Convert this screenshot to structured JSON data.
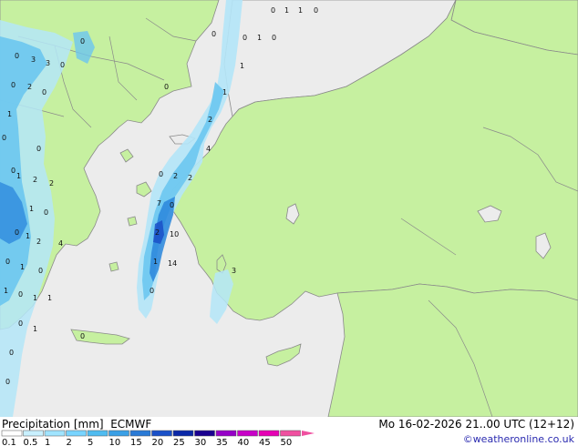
{
  "legend": {
    "title": "Precipitation [mm]",
    "model": "ECMWF",
    "datetime": "Mo 16-02-2026 21..00 UTC (12+12)",
    "credit": "©weatheronline.co.uk",
    "scale_labels": [
      "0.1",
      "0.5",
      "1",
      "2",
      "5",
      "10",
      "15",
      "20",
      "25",
      "30",
      "35",
      "40",
      "45",
      "50"
    ],
    "scale_colors": [
      "#ffffff",
      "#c8f0ff",
      "#a0e4ff",
      "#78d4ff",
      "#50bcf0",
      "#3aa0e6",
      "#2a7ad6",
      "#1a50c8",
      "#0a28a8",
      "#1a0090",
      "#9600c8",
      "#c800c8",
      "#e600b4",
      "#f050a0"
    ]
  },
  "colors": {
    "sea": "#ececec",
    "land": "#c6f0a0",
    "border": "#8a8a8a",
    "precip_light": "#b4e6f8",
    "precip_mid": "#6cc6f0",
    "precip_heavy": "#2a86dc",
    "precip_core": "#1a50c8"
  },
  "map_labels": [
    {
      "text": "0"
    },
    {
      "text": "1"
    },
    {
      "text": "1"
    },
    {
      "text": "0"
    },
    {
      "text": "0"
    },
    {
      "text": "1"
    },
    {
      "text": "0"
    },
    {
      "text": "0"
    },
    {
      "text": "3"
    },
    {
      "text": "3"
    },
    {
      "text": "0"
    },
    {
      "text": "0"
    },
    {
      "text": "2"
    },
    {
      "text": "0"
    },
    {
      "text": "0"
    },
    {
      "text": "0"
    },
    {
      "text": "1"
    },
    {
      "text": "0"
    },
    {
      "text": "1"
    },
    {
      "text": "2"
    },
    {
      "text": "2"
    },
    {
      "text": "0"
    },
    {
      "text": "1"
    },
    {
      "text": "0"
    },
    {
      "text": "1"
    },
    {
      "text": "2"
    },
    {
      "text": "4"
    },
    {
      "text": "0"
    },
    {
      "text": "1"
    },
    {
      "text": "0"
    },
    {
      "text": "1"
    },
    {
      "text": "0"
    },
    {
      "text": "1"
    },
    {
      "text": "1"
    },
    {
      "text": "0"
    },
    {
      "text": "0"
    },
    {
      "text": "0"
    },
    {
      "text": "1"
    },
    {
      "text": "0"
    },
    {
      "text": "1"
    },
    {
      "text": "0"
    },
    {
      "text": "0"
    },
    {
      "text": "0"
    },
    {
      "text": "1"
    },
    {
      "text": "2"
    },
    {
      "text": "4"
    },
    {
      "text": "0"
    },
    {
      "text": "2"
    },
    {
      "text": "2"
    },
    {
      "text": "7"
    },
    {
      "text": "0"
    },
    {
      "text": "2"
    },
    {
      "text": "10"
    },
    {
      "text": "1"
    },
    {
      "text": "14"
    },
    {
      "text": "0"
    },
    {
      "text": "3"
    },
    {
      "text": "1"
    }
  ]
}
